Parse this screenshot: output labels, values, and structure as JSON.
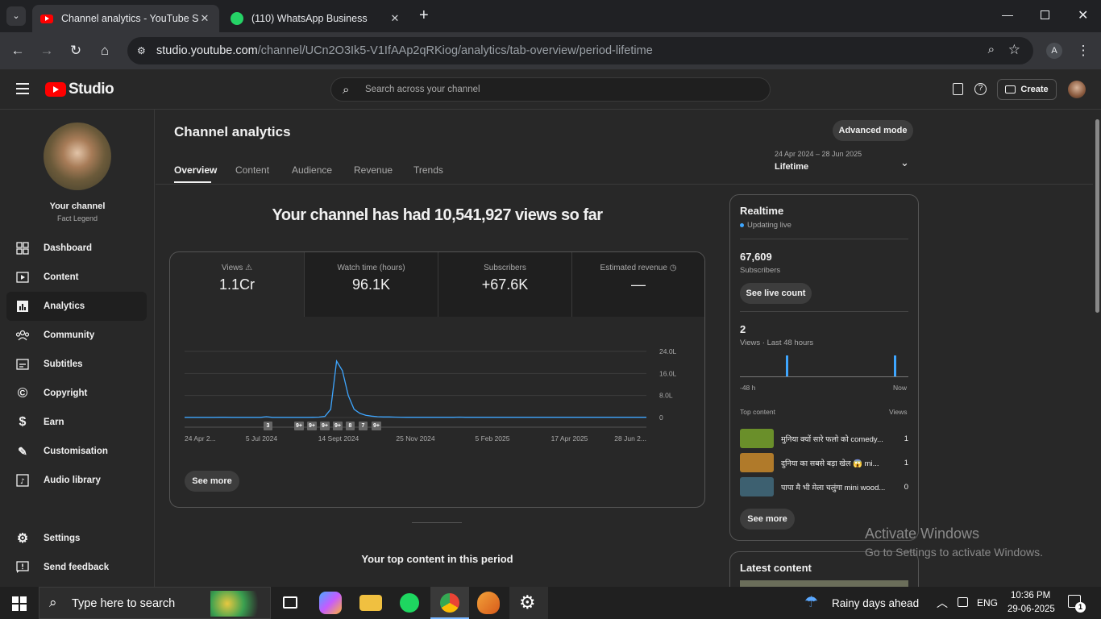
{
  "browser": {
    "tabs": [
      {
        "label": "Channel analytics - YouTube Studio",
        "active": true
      },
      {
        "label": "(110) WhatsApp Business",
        "active": false
      }
    ],
    "url_host": "studio.youtube.com",
    "url_path": "/channel/UCn2O3Ik5-V1IfAAp2qRKiog/analytics/tab-overview/period-lifetime",
    "profile_initial": "A"
  },
  "header": {
    "logo_text": "Studio",
    "search_placeholder": "Search across your channel",
    "create_label": "Create"
  },
  "sidebar": {
    "channel_title": "Your channel",
    "channel_name": "Fact Legend",
    "items": [
      {
        "label": "Dashboard",
        "icon": "dashboard-icon"
      },
      {
        "label": "Content",
        "icon": "content-icon"
      },
      {
        "label": "Analytics",
        "icon": "analytics-icon",
        "active": true
      },
      {
        "label": "Community",
        "icon": "community-icon"
      },
      {
        "label": "Subtitles",
        "icon": "subtitles-icon"
      },
      {
        "label": "Copyright",
        "icon": "copyright-icon"
      },
      {
        "label": "Earn",
        "icon": "earn-icon"
      },
      {
        "label": "Customisation",
        "icon": "customisation-icon"
      },
      {
        "label": "Audio library",
        "icon": "audio-library-icon"
      }
    ],
    "settings_label": "Settings",
    "feedback_label": "Send feedback"
  },
  "main": {
    "page_title": "Channel analytics",
    "advanced_mode_label": "Advanced mode",
    "tabs": [
      "Overview",
      "Content",
      "Audience",
      "Revenue",
      "Trends"
    ],
    "period_range": "24 Apr 2024 – 28 Jun 2025",
    "period_label": "Lifetime",
    "headline": "Your channel has had 10,541,927 views so far",
    "metrics": [
      {
        "label": "Views",
        "value": "1.1Cr"
      },
      {
        "label": "Watch time (hours)",
        "value": "96.1K"
      },
      {
        "label": "Subscribers",
        "value": "+67.6K"
      },
      {
        "label": "Estimated revenue",
        "value": "—"
      }
    ],
    "see_more_label": "See more",
    "top_content_heading": "Your top content in this period"
  },
  "chart_data": {
    "type": "line",
    "series": [
      {
        "values": [
          0.05,
          0.05,
          0.06,
          0.05,
          0.06,
          0.05,
          0.1,
          0.08,
          0.06,
          0.05,
          0.05,
          0.06,
          0.05,
          0.05,
          0.3,
          0.05,
          0.05,
          0.05,
          0.05,
          0.05,
          0.05,
          0.07,
          0.1,
          0.15,
          0.4,
          3.0,
          20.5,
          17.0,
          8.0,
          3.0,
          1.5,
          0.8,
          0.5,
          0.3,
          0.2,
          0.2,
          0.15,
          0.12,
          0.1,
          0.1,
          0.1,
          0.1,
          0.1,
          0.1,
          0.1,
          0.1,
          0.1,
          0.15,
          0.1,
          0.1,
          0.08,
          0.08,
          0.08,
          0.08,
          0.08,
          0.08,
          0.08,
          0.08,
          0.08,
          0.08,
          0.08,
          0.08,
          0.08,
          0.08,
          0.08,
          0.08,
          0.08,
          0.08,
          0.08,
          0.08,
          0.08,
          0.08,
          0.08,
          0.08,
          0.08,
          0.08,
          0.08,
          0.08,
          0.08,
          0.08
        ]
      }
    ],
    "x_tick_labels": [
      "24 Apr 2...",
      "5 Jul 2024",
      "14 Sept 2024",
      "25 Nov 2024",
      "5 Feb 2025",
      "17 Apr 2025",
      "28 Jun 2..."
    ],
    "y_tick_labels": [
      "24.0L",
      "16.0L",
      "8.0L",
      "0"
    ],
    "ylim": [
      0,
      24
    ],
    "grid": true,
    "annotations": [
      "3",
      "9+",
      "9+",
      "9+",
      "9+",
      "8",
      "7",
      "9+"
    ],
    "line_color": "#3ea6ff"
  },
  "realtime": {
    "title": "Realtime",
    "status": "Updating live",
    "subscribers_value": "67,609",
    "subscribers_label": "Subscribers",
    "live_count_label": "See live count",
    "views_value": "2",
    "views_label": "Views · Last 48 hours",
    "axis_left": "-48 h",
    "axis_right": "Now",
    "top_content_label": "Top content",
    "views_col_label": "Views",
    "items": [
      {
        "title": "मुनिया क्यों सारे फलो को comedy...",
        "views": "1",
        "thumb": "#6a8f2a"
      },
      {
        "title": "दुनिया का सबसे बड़ा खेल 😱 mi...",
        "views": "1",
        "thumb": "#b07a2a"
      },
      {
        "title": "पापा मै भी मेला चलुंगा mini wood...",
        "views": "0",
        "thumb": "#3d6070"
      }
    ],
    "see_more_label": "See more",
    "latest_content_title": "Latest content"
  },
  "watermark": {
    "line1": "Activate Windows",
    "line2": "Go to Settings to activate Windows."
  },
  "taskbar": {
    "search_placeholder": "Type here to search",
    "weather": "Rainy days ahead",
    "language": "ENG",
    "time": "10:36 PM",
    "date": "29-06-2025",
    "notification_count": "1"
  }
}
